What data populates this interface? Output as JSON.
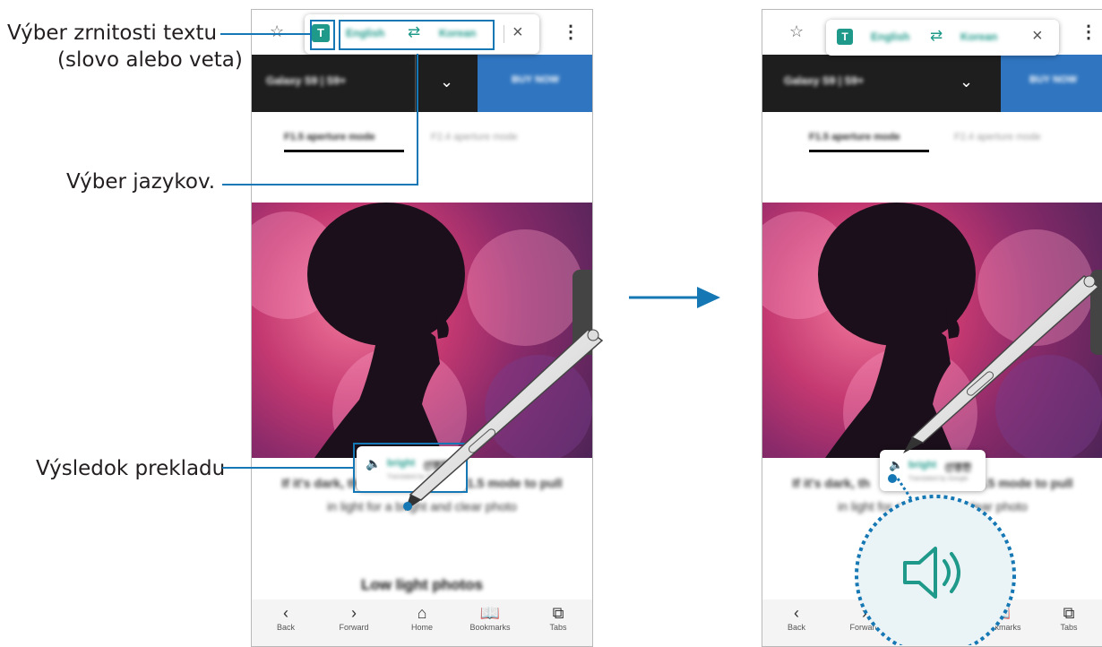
{
  "callouts": {
    "granularity": "Výber zrnitosti textu",
    "granularity_sub": "(slovo alebo veta)",
    "languages": "Výber jazykov.",
    "result": "Výsledok prekladu"
  },
  "translate_bar": {
    "source_lang": "English",
    "target_lang": "Korean",
    "swap_icon": "swap-arrows",
    "close_icon": "close"
  },
  "page": {
    "tab_title": "Galaxy S9 | S9+",
    "tab_button": "BUY NOW",
    "subnav_active": "F1.5 aperture mode",
    "subnav_inactive": "F2.4 aperture mode",
    "caption_line1_left": "If it's dark, th",
    "caption_line1_right": "1.5 mode to pull",
    "caption_line2": "in light for a bright and clear photo",
    "caption_line1_right_panel_left": "If it's dark, th",
    "caption_line1_right_panel_right": "1.5 mode to pull",
    "section_title": "Low light photos"
  },
  "translation": {
    "word": "bright",
    "translated": "선명한",
    "source_note": "Translated by Google"
  },
  "bottom_nav": [
    {
      "label": "Back",
      "icon": "chevron-left"
    },
    {
      "label": "Forward",
      "icon": "chevron-right"
    },
    {
      "label": "Home",
      "icon": "home"
    },
    {
      "label": "Bookmarks",
      "icon": "book"
    },
    {
      "label": "Tabs",
      "icon": "tabs"
    }
  ],
  "colors": {
    "highlight": "#1578b4",
    "accent_blue": "#2f75c0",
    "dark_tab": "#1e1e1e",
    "speaker_teal": "#1f9a8a"
  }
}
